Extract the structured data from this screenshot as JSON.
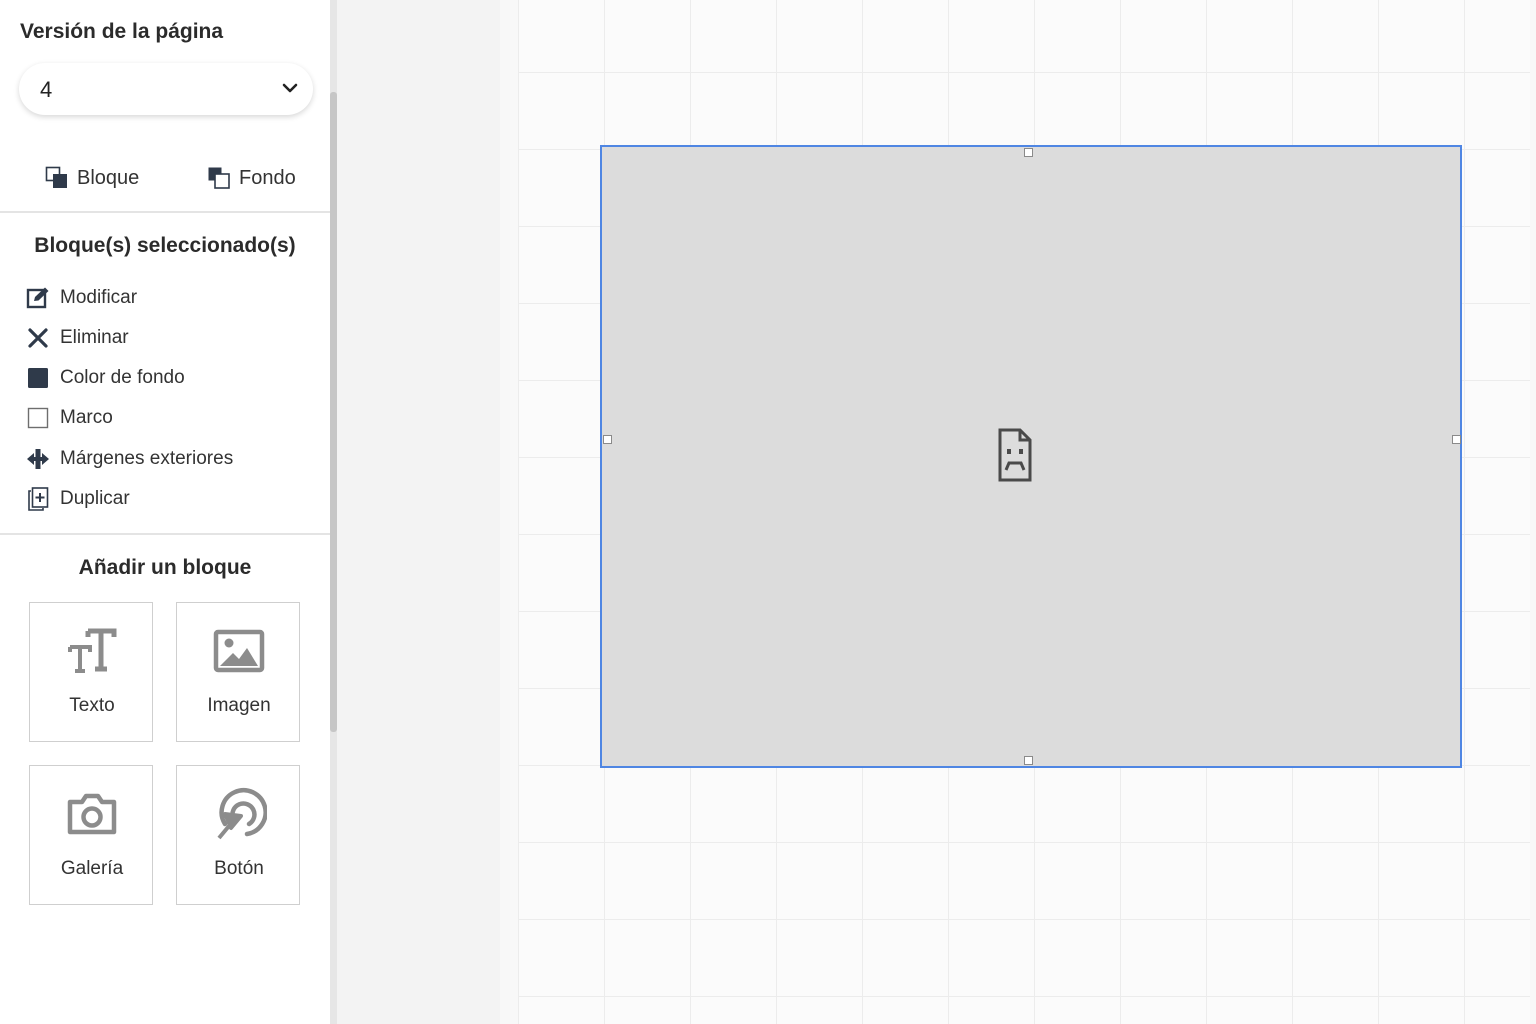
{
  "sidebar": {
    "version_label": "Versión de la página",
    "version_value": "4",
    "tabs": [
      {
        "label": "Bloque",
        "icon": "block-layer-icon"
      },
      {
        "label": "Fondo",
        "icon": "background-layer-icon"
      }
    ],
    "selected_title": "Bloque(s) seleccionado(s)",
    "actions": [
      {
        "label": "Modificar",
        "icon": "edit-icon"
      },
      {
        "label": "Eliminar",
        "icon": "close-icon"
      },
      {
        "label": "Color de fondo",
        "icon": "filled-square-icon"
      },
      {
        "label": "Marco",
        "icon": "empty-square-icon"
      },
      {
        "label": "Márgenes exteriores",
        "icon": "move-arrows-icon"
      },
      {
        "label": "Duplicar",
        "icon": "duplicate-icon"
      }
    ],
    "add_title": "Añadir un bloque",
    "add_blocks": [
      {
        "label": "Texto",
        "icon": "text-icon"
      },
      {
        "label": "Imagen",
        "icon": "image-icon"
      },
      {
        "label": "Galería",
        "icon": "camera-icon"
      },
      {
        "label": "Botón",
        "icon": "button-click-icon"
      }
    ]
  },
  "canvas": {
    "selected_block_icon": "broken-image-icon"
  },
  "colors": {
    "accent": "#4f86e3",
    "icon_dark": "#2f3a4a",
    "icon_gray": "#8c8c8c",
    "placeholder": "#dcdcdc"
  }
}
